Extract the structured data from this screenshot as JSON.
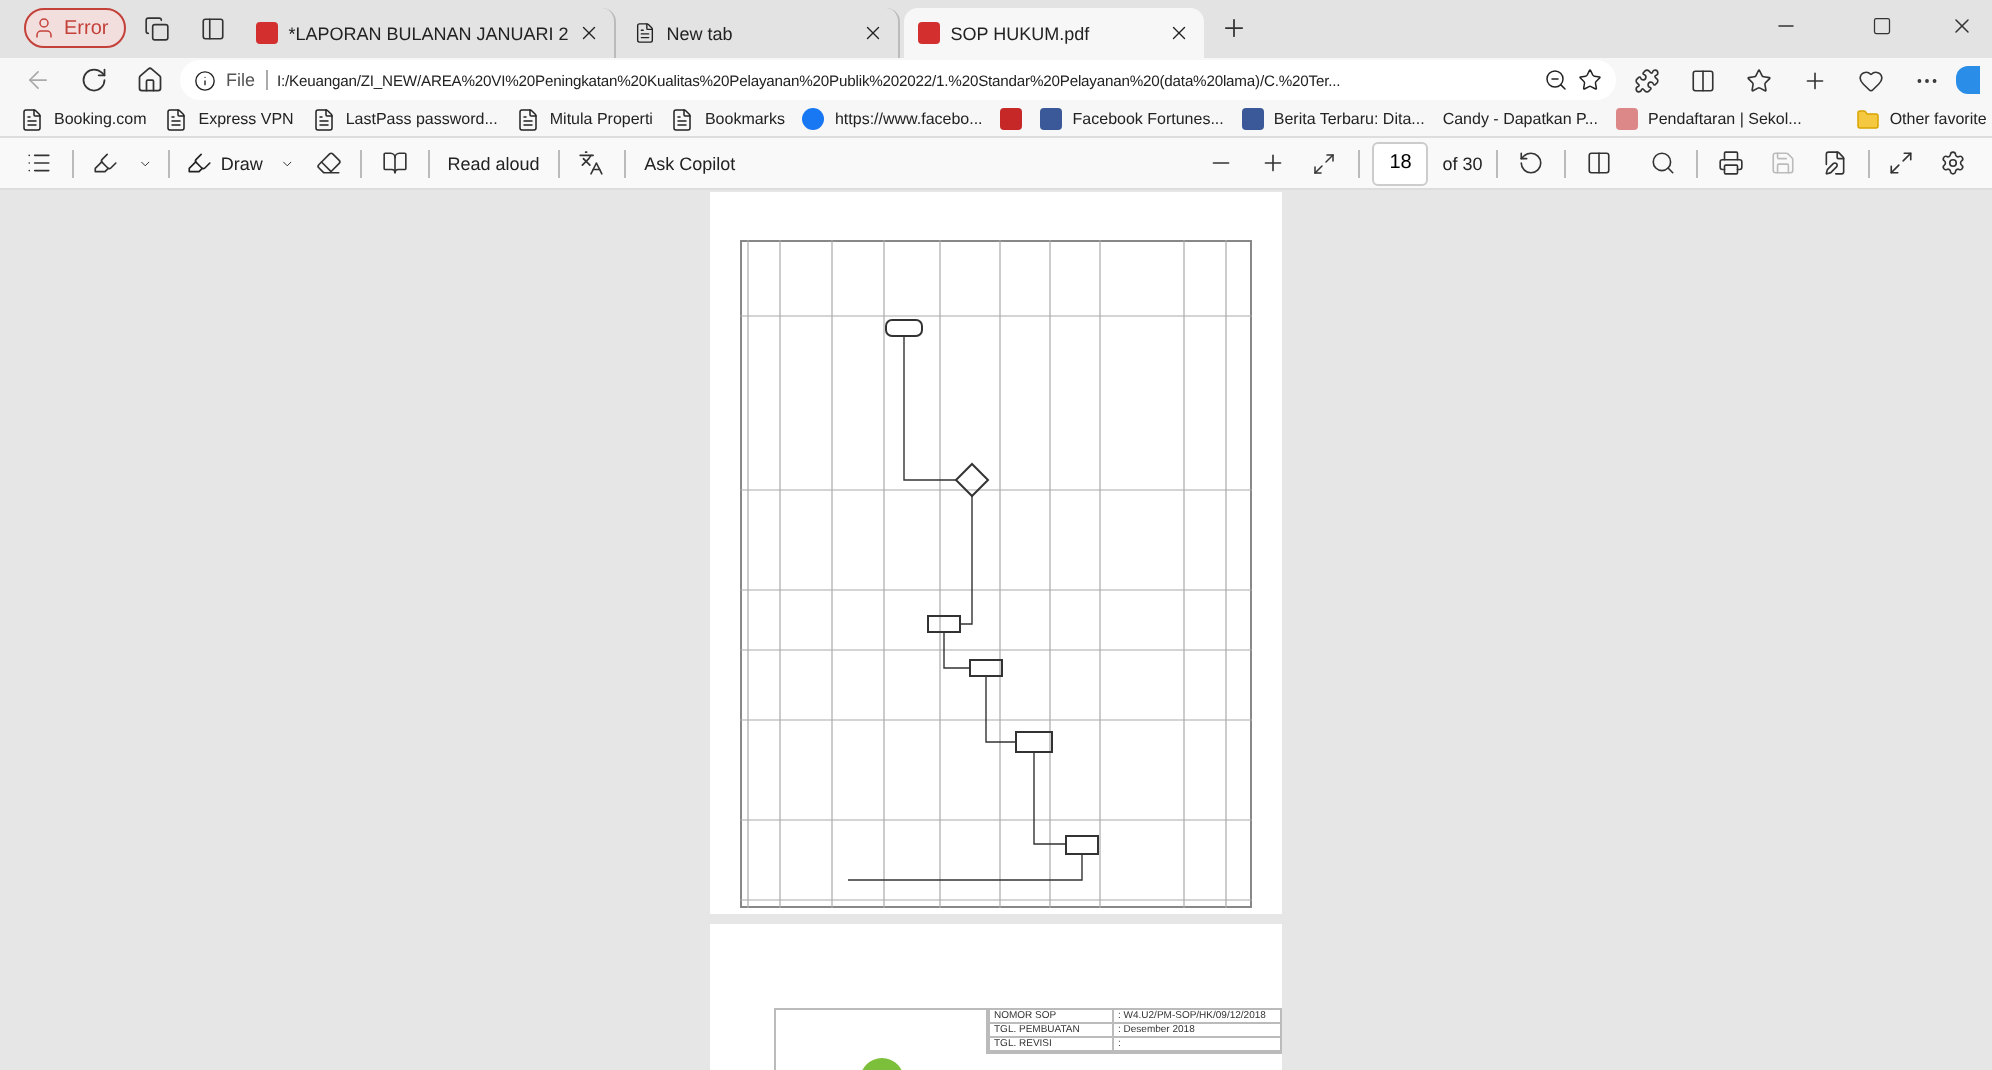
{
  "profile": {
    "label": "Error"
  },
  "tabs": [
    {
      "title": "*LAPORAN BULANAN JANUARI 2",
      "kind": "pdf",
      "selected": false
    },
    {
      "title": "New tab",
      "kind": "page",
      "selected": false
    },
    {
      "title": "SOP HUKUM.pdf",
      "kind": "pdf",
      "selected": true
    }
  ],
  "address_bar": {
    "scheme": "File",
    "url": "I:/Keuangan/ZI_NEW/AREA%20VI%20Peningkatan%20Kualitas%20Pelayanan%20Publik%202022/1.%20Standar%20Pelayanan%20(data%20lama)/C.%20Ter..."
  },
  "bookmarks": [
    {
      "label": "Booking.com",
      "kind": "page"
    },
    {
      "label": "Express VPN",
      "kind": "page"
    },
    {
      "label": "LastPass password...",
      "kind": "page"
    },
    {
      "label": "Mitula Properti",
      "kind": "page"
    },
    {
      "label": "Bookmarks",
      "kind": "page"
    },
    {
      "label": "https://www.facebo...",
      "kind": "facebook"
    },
    {
      "kind": "pdf"
    },
    {
      "label": "Facebook Fortunes...",
      "kind": "ff"
    },
    {
      "label": "Berita Terbaru: Dita...",
      "kind": "ff"
    },
    {
      "label": "Candy - Dapatkan P...",
      "kind": "blank"
    },
    {
      "label": "Pendaftaran | Sekol...",
      "kind": "site"
    }
  ],
  "other_favorites": "Other favorite",
  "pdf_toolbar": {
    "draw": "Draw",
    "read_aloud": "Read aloud",
    "ask_copilot": "Ask Copilot",
    "page": "18",
    "page_count": "of 30"
  },
  "next_page": {
    "rows": [
      {
        "label": "NOMOR SOP",
        "value": ": W4.U2/PM-SOP/HK/09/12/2018"
      },
      {
        "label": "TGL. PEMBUATAN",
        "value": ":       Desember 2018"
      },
      {
        "label": "TGL. REVISI",
        "value": ":"
      }
    ]
  }
}
